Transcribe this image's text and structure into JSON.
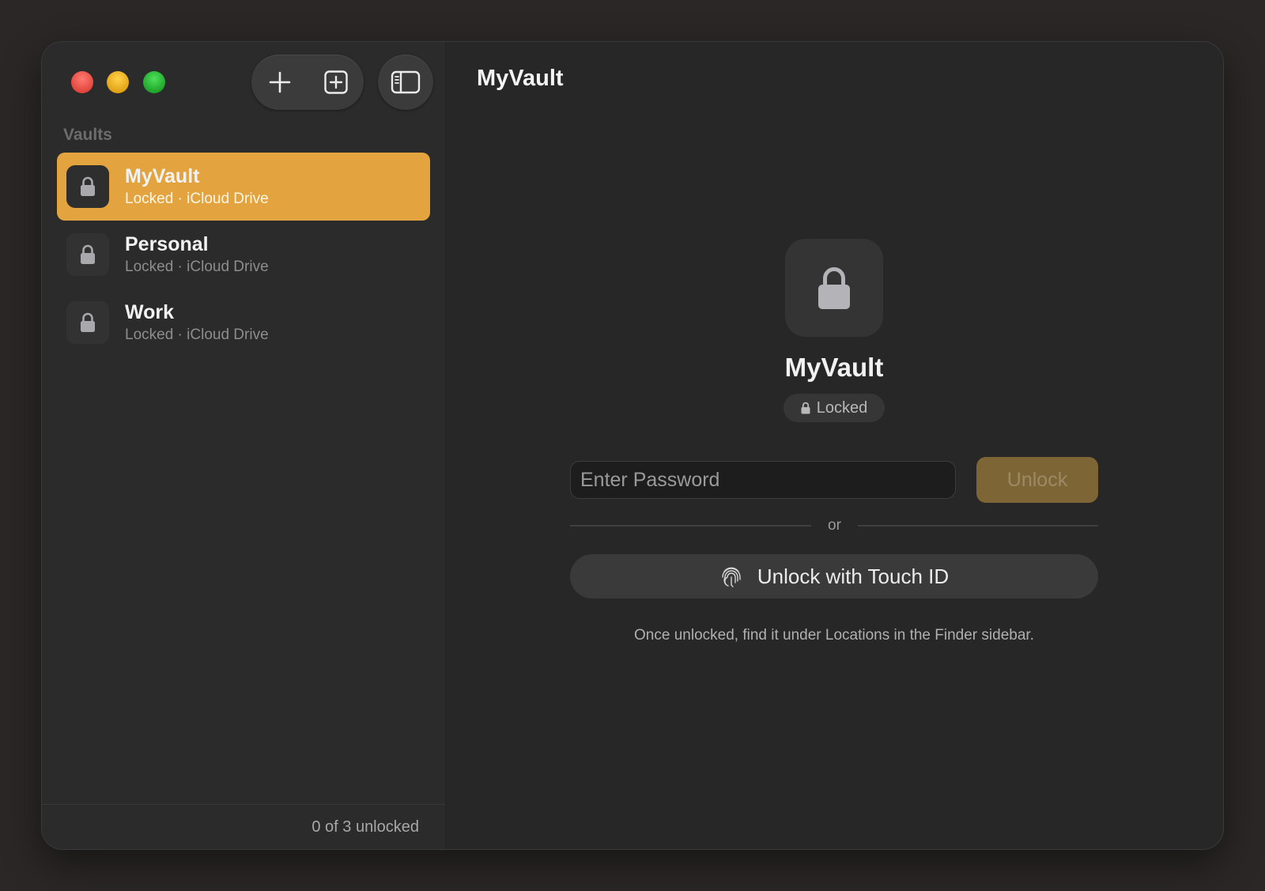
{
  "window": {
    "title": "MyVault"
  },
  "toolbar": {
    "add_icon": "plus-icon",
    "add_box_icon": "plus-square-icon",
    "sidebar_icon": "sidebar-toggle-icon"
  },
  "sidebar": {
    "section_label": "Vaults",
    "vaults": [
      {
        "name": "MyVault",
        "status": "Locked · iCloud Drive",
        "selected": true
      },
      {
        "name": "Personal",
        "status": "Locked · iCloud Drive",
        "selected": false
      },
      {
        "name": "Work",
        "status": "Locked · iCloud Drive",
        "selected": false
      }
    ],
    "footer": "0 of 3 unlocked"
  },
  "detail": {
    "vault_name": "MyVault",
    "status_badge": "Locked",
    "password_placeholder": "Enter Password",
    "unlock_label": "Unlock",
    "or_label": "or",
    "touch_id_label": "Unlock with Touch ID",
    "hint": "Once unlocked, find it under Locations in the Finder sidebar."
  },
  "colors": {
    "accent": "#e3a440",
    "unlock_disabled": "#7e6535",
    "traffic_red": "#e2463e",
    "traffic_yellow": "#e3a316",
    "traffic_green": "#1fa62b"
  }
}
